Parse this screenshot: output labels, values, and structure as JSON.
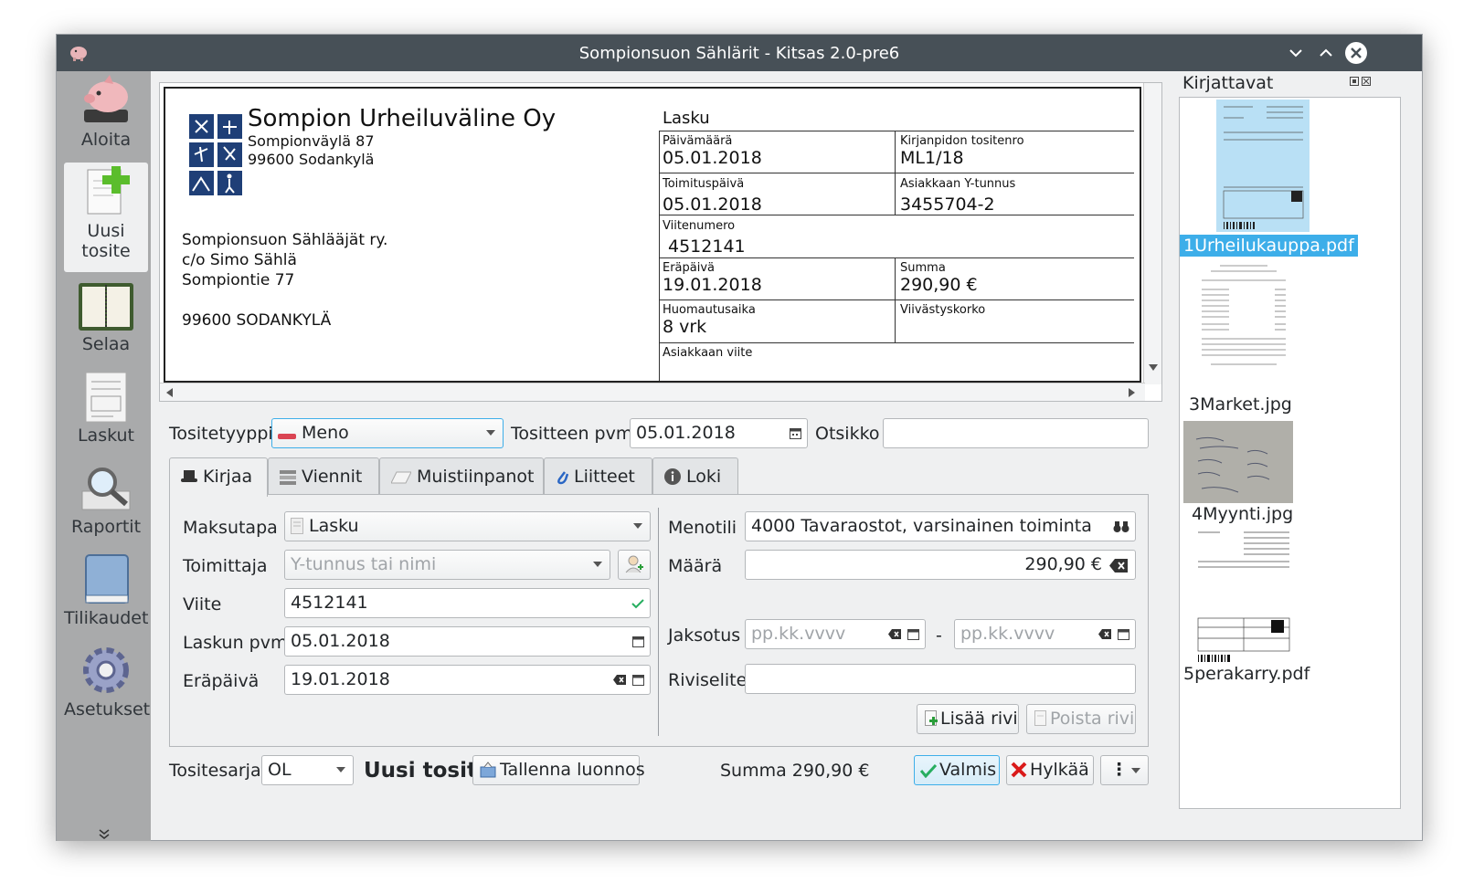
{
  "window": {
    "title": "Sompionsuon Sählärit - Kitsas 2.0-pre6"
  },
  "sidebar": {
    "items": [
      {
        "label": "Aloita",
        "icon": "piggy-bank-icon"
      },
      {
        "label": "Uusi tosite",
        "line1": "Uusi",
        "line2": "tosite",
        "icon": "new-document-icon"
      },
      {
        "label": "Selaa",
        "icon": "calendar-book-icon"
      },
      {
        "label": "Laskut",
        "icon": "invoice-icon"
      },
      {
        "label": "Raportit",
        "icon": "magnifier-report-icon"
      },
      {
        "label": "Tilikaudet",
        "icon": "book-icon"
      },
      {
        "label": "Asetukset",
        "icon": "gear-icon"
      }
    ],
    "more": "»"
  },
  "invoice": {
    "company": "Sompion Urheiluväline Oy",
    "company_addr1": "Sompionväylä 87",
    "company_addr2": "99600 Sodankylä",
    "recipient": [
      "Sompionsuon Sählääjät ry.",
      "c/o Simo Sählä",
      "Sompiontie 77",
      "",
      "99600 SODANKYLÄ"
    ],
    "heading": "Lasku",
    "fields": {
      "date_label": "Päivämäärä",
      "date": "05.01.2018",
      "voucher_label": "Kirjanpidon tositenro",
      "voucher": "ML1/18",
      "delivery_label": "Toimituspäivä",
      "delivery": "05.01.2018",
      "ytunnus_label": "Asiakkaan Y-tunnus",
      "ytunnus": "3455704-2",
      "ref_label": "Viitenumero",
      "ref": "4512141",
      "due_label": "Eräpäivä",
      "due": "19.01.2018",
      "sum_label": "Summa",
      "sum": "290,90 €",
      "notice_label": "Huomautusaika",
      "notice": "8 vrk",
      "interest_label": "Viivästyskorko",
      "custref_label": "Asiakkaan viite"
    }
  },
  "header": {
    "type_label": "Tositetyyppi",
    "type_value": "Meno",
    "date_label": "Tositteen pvm",
    "date_value": "05.01.2018",
    "title_label": "Otsikko",
    "title_value": ""
  },
  "tabs": [
    {
      "label": "Kirjaa",
      "icon": "hat-icon"
    },
    {
      "label": "Viennit",
      "icon": "list-icon"
    },
    {
      "label": "Muistiinpanot",
      "icon": "note-icon"
    },
    {
      "label": "Liitteet",
      "icon": "paperclip-icon"
    },
    {
      "label": "Loki",
      "icon": "info-icon"
    }
  ],
  "form": {
    "payment_label": "Maksutapa",
    "payment_value": "Lasku",
    "supplier_label": "Toimittaja",
    "supplier_placeholder": "Y-tunnus tai nimi",
    "ref_label": "Viite",
    "ref_value": "4512141",
    "invdate_label": "Laskun pvm",
    "invdate_value": "05.01.2018",
    "due_label": "Eräpäivä",
    "due_value": "19.01.2018",
    "account_label": "Menotili",
    "account_value": "4000 Tavaraostot, varsinainen toiminta",
    "amount_label": "Määrä",
    "amount_value": "290,90 €",
    "period_label": "Jaksotus",
    "period_from_placeholder": "pp.kk.vvvv",
    "period_dash": "-",
    "period_to_placeholder": "pp.kk.vvvv",
    "rowdesc_label": "Riviselite",
    "rowdesc_value": "",
    "add_row": "Lisää rivi",
    "remove_row": "Poista rivi"
  },
  "footer": {
    "series_label": "Tositesarja",
    "series_value": "OL",
    "new_voucher": "Uusi tosite",
    "save_draft": "Tallenna luonnos",
    "sum": "Summa 290,90 €",
    "ready": "Valmis",
    "reject": "Hylkää",
    "menu": "⋮"
  },
  "attachments": {
    "title": "Kirjattavat",
    "items": [
      "1Urheilukauppa.pdf",
      "3Market.jpg",
      "4Myynti.jpg",
      "5perakarry.pdf"
    ]
  },
  "colors": {
    "accent": "#3daee9",
    "titlebar": "#475057",
    "selected": "#3daee9"
  }
}
